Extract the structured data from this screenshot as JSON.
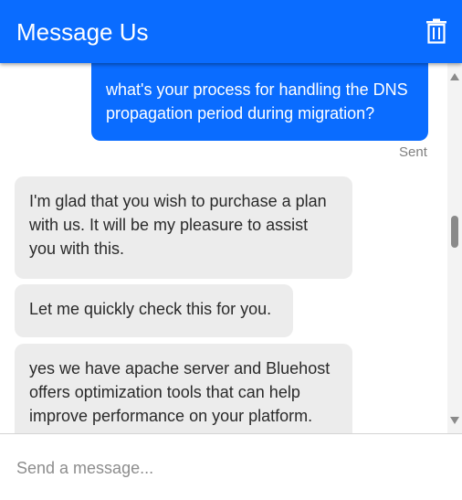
{
  "header": {
    "title": "Message Us",
    "trash_icon": "trash-icon"
  },
  "colors": {
    "accent": "#0a6cff",
    "agent_bubble": "#ececec",
    "status_text": "#7f7f7f"
  },
  "messages": [
    {
      "from": "user",
      "text": "what's your process for handling the DNS propagation period during migration?",
      "status": "Sent"
    },
    {
      "from": "agent",
      "text": "I'm glad that you wish to purchase a plan with us. It will be my pleasure to assist you with this."
    },
    {
      "from": "agent",
      "text": "Let me quickly check this for you."
    },
    {
      "from": "agent",
      "text": "yes we have apache server and Bluehost offers optimization tools that can help improve performance on your platform."
    }
  ],
  "composer": {
    "placeholder": "Send a message..."
  }
}
